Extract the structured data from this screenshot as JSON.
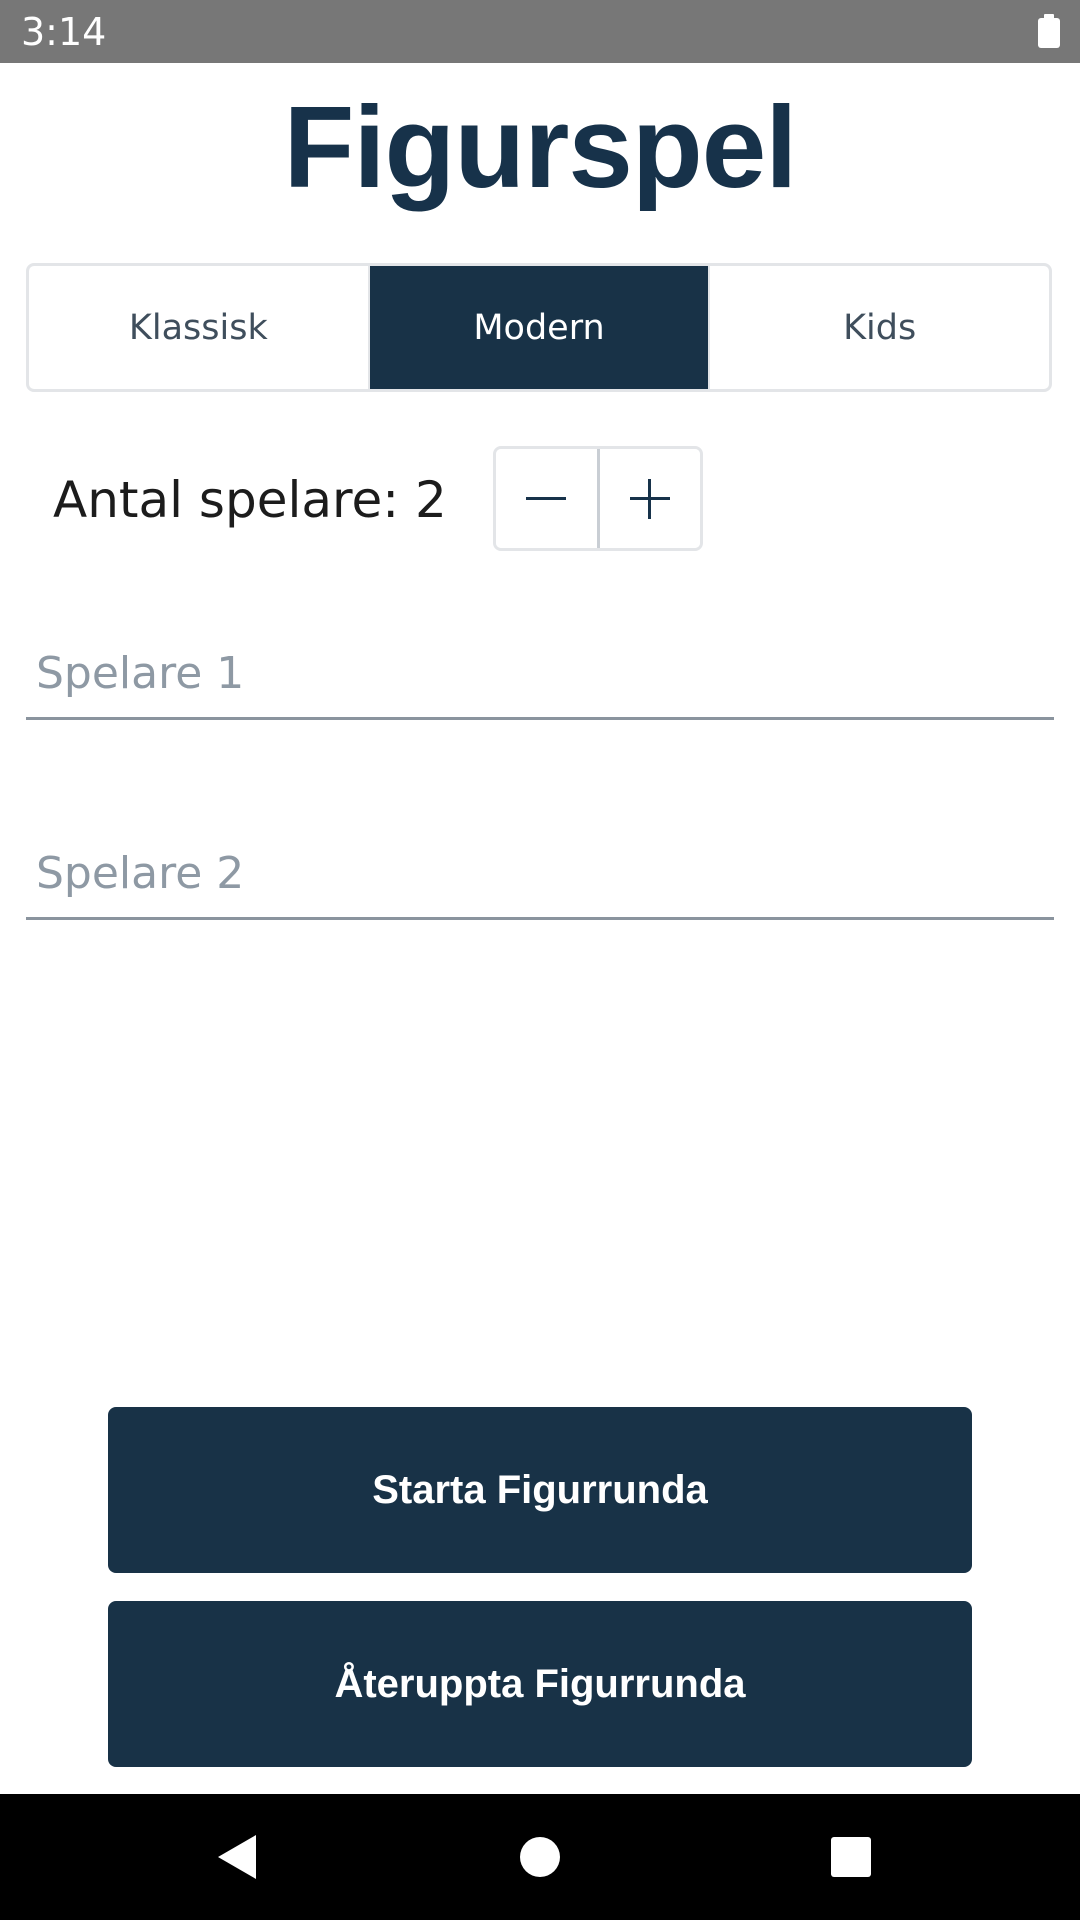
{
  "status_bar": {
    "time": "3:14",
    "battery_icon": "battery-full-icon"
  },
  "app": {
    "title": "Figurspel"
  },
  "mode_selector": {
    "options": [
      "Klassisk",
      "Modern",
      "Kids"
    ],
    "selected": "Modern"
  },
  "players": {
    "count_label": "Antal spelare: 2",
    "count": 2,
    "decrement_icon": "minus-icon",
    "increment_icon": "plus-icon",
    "fields": [
      {
        "placeholder": "Spelare 1",
        "value": ""
      },
      {
        "placeholder": "Spelare 2",
        "value": ""
      }
    ]
  },
  "actions": {
    "start_label": "Starta Figurrunda",
    "resume_label": "Återuppta Figurrunda"
  },
  "nav_bar": {
    "back_icon": "back-icon",
    "home_icon": "home-icon",
    "recents_icon": "recents-icon"
  },
  "colors": {
    "primary": "#183247",
    "status_bar": "#777777",
    "nav_bar": "#000000",
    "border": "#e3e5e8",
    "placeholder": "#8e99a4"
  }
}
